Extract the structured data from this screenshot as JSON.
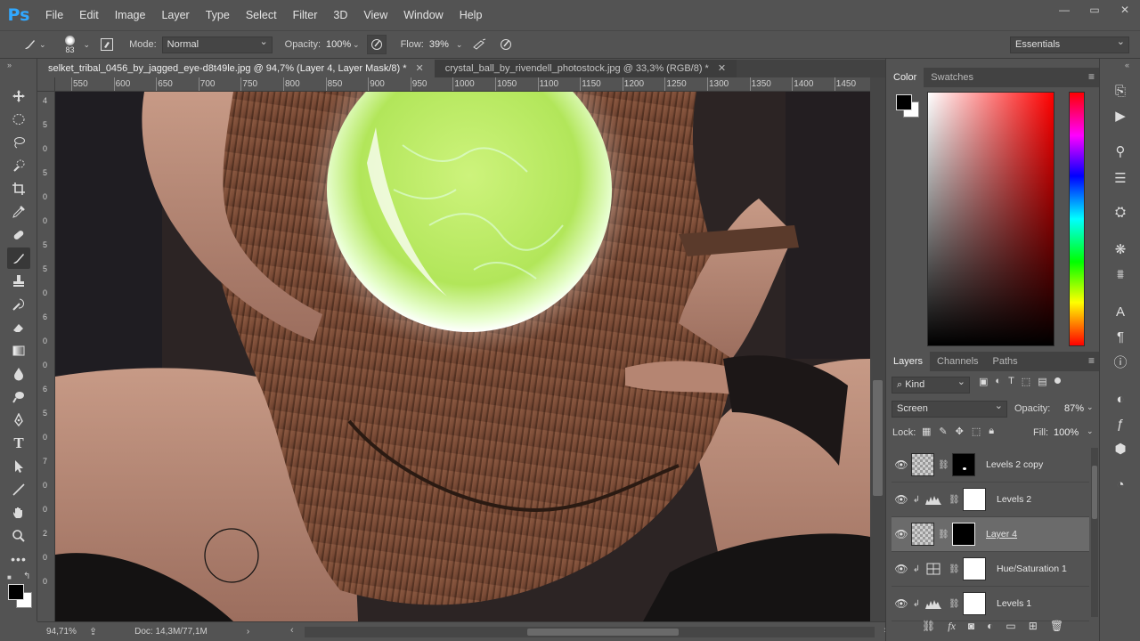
{
  "app": {
    "logo": "Ps",
    "menu": [
      "File",
      "Edit",
      "Image",
      "Layer",
      "Type",
      "Select",
      "Filter",
      "3D",
      "View",
      "Window",
      "Help"
    ],
    "window_controls": [
      "—",
      "▭",
      "✕"
    ]
  },
  "options": {
    "brush_size": "83",
    "mode_label": "Mode:",
    "mode_value": "Normal",
    "opacity_label": "Opacity:",
    "opacity_value": "100%",
    "flow_label": "Flow:",
    "flow_value": "39%",
    "workspace": "Essentials"
  },
  "tabs": [
    {
      "label": "selket_tribal_0456_by_jagged_eye-d8t49le.jpg @ 94,7% (Layer 4, Layer Mask/8) *",
      "close": "✕"
    },
    {
      "label": "crystal_ball_by_rivendell_photostock.jpg @ 33,3% (RGB/8) *",
      "close": "✕"
    }
  ],
  "ruler_h": [
    "550",
    "600",
    "650",
    "700",
    "750",
    "800",
    "850",
    "900",
    "950",
    "1000",
    "1050",
    "1100",
    "1150",
    "1200",
    "1250",
    "1300",
    "1350",
    "1400",
    "1450"
  ],
  "ruler_v": [
    "4",
    "5",
    "0",
    "5",
    "0",
    "0",
    "5",
    "5",
    "0",
    "6",
    "0",
    "0",
    "6",
    "5",
    "0",
    "7",
    "0",
    "0",
    "2",
    "0",
    "0"
  ],
  "status": {
    "zoom": "94,71%",
    "doc": "Doc: 14,3M/77,1M"
  },
  "color_panel": {
    "tabs": [
      "Color",
      "Swatches"
    ],
    "foreground": "#000000",
    "background": "#ffffff"
  },
  "layers_panel": {
    "tabs": [
      "Layers",
      "Channels",
      "Paths"
    ],
    "filter_label": "Kind",
    "blend_mode": "Screen",
    "opacity_label": "Opacity:",
    "opacity_value": "87%",
    "lock_label": "Lock:",
    "fill_label": "Fill:",
    "fill_value": "100%",
    "layers": [
      {
        "name": "Levels 2 copy",
        "selected": false
      },
      {
        "name": "Levels 2",
        "selected": false
      },
      {
        "name": "Layer 4",
        "selected": true
      },
      {
        "name": "Hue/Saturation 1",
        "selected": false
      },
      {
        "name": "Levels 1",
        "selected": false
      }
    ]
  },
  "colors": {
    "ui_bg": "#535353",
    "ps_blue": "#31a8ff",
    "orb_green": "#b6ea62"
  }
}
